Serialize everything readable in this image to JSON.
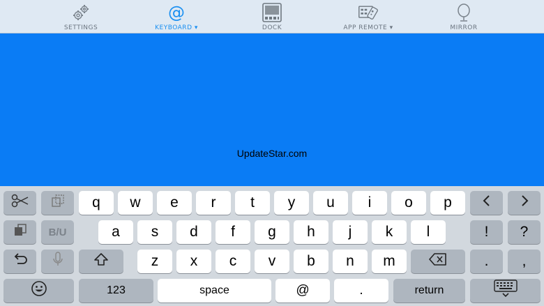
{
  "toolbar": {
    "items": [
      {
        "label": "SETTINGS",
        "icon": "gears-icon"
      },
      {
        "label": "KEYBOARD ▾",
        "icon": "at-sign-icon",
        "active": true
      },
      {
        "label": "DOCK",
        "icon": "dock-icon"
      },
      {
        "label": "APP REMOTE ▾",
        "icon": "app-remote-icon"
      },
      {
        "label": "MIRROR",
        "icon": "mirror-icon"
      }
    ],
    "active_color": "#1a8ff1"
  },
  "canvas": {
    "background": "#0a7cf5",
    "watermark": "UpdateStar.com"
  },
  "keyboard": {
    "row1": [
      "q",
      "w",
      "e",
      "r",
      "t",
      "y",
      "u",
      "i",
      "o",
      "p"
    ],
    "row2": [
      "a",
      "s",
      "d",
      "f",
      "g",
      "h",
      "j",
      "k",
      "l"
    ],
    "row3": [
      "z",
      "x",
      "c",
      "v",
      "b",
      "n",
      "m"
    ],
    "bold_underline": "B/U",
    "numbers": "123",
    "space": "space",
    "at": "@",
    "dot": ".",
    "return": "return",
    "exclaim": "!",
    "question": "?",
    "period": ".",
    "comma": ","
  }
}
